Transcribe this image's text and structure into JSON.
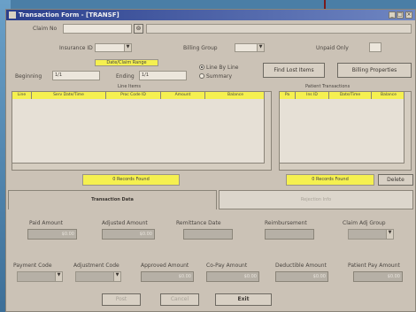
{
  "window": {
    "title": "Transaction Form - [TRANSF]"
  },
  "header": {
    "claim_no_label": "Claim No",
    "claim_no_value": "",
    "insurance_id_label": "Insurance ID",
    "billing_group_label": "Billing Group",
    "unpaid_only_label": "Unpaid Only",
    "date_range_label": "Date/Claim Range",
    "beginning_label": "Beginning",
    "beginning_value": "1/1",
    "ending_label": "Ending",
    "ending_value": "1/1",
    "radio_line_by_line": "Line By Line",
    "radio_summary": "Summary",
    "find_lost_items_label": "Find Lost Items",
    "billing_properties_label": "Billing Properties"
  },
  "left_grid": {
    "group_label": "Line Items",
    "columns": [
      "Line",
      "Serv Date/Time",
      "Proc Code ID",
      "Amount",
      "Balance"
    ],
    "count_label": "0 Records Found"
  },
  "right_grid": {
    "group_label": "Patient Transactions",
    "columns": [
      "Pa",
      "Ins ID",
      "Date/Time",
      "Balance"
    ],
    "count_label": "0 Records Found",
    "delete_label": "Delete"
  },
  "tabs": {
    "active": "Transaction Data",
    "inactive": "Rejection Info"
  },
  "amounts": {
    "row1": [
      {
        "label": "Paid Amount",
        "value": "$0.00"
      },
      {
        "label": "Adjusted Amount",
        "value": "$0.00"
      },
      {
        "label": "Remittance Date",
        "value": ""
      },
      {
        "label": "Reimbursement",
        "value": ""
      },
      {
        "label": "Claim Adj Group",
        "value": ""
      }
    ],
    "row2": [
      {
        "label": "Payment Code",
        "value": ""
      },
      {
        "label": "Adjustment Code",
        "value": ""
      },
      {
        "label": "Approved Amount",
        "value": "$0.00"
      },
      {
        "label": "Co-Pay Amount",
        "value": "$0.00"
      },
      {
        "label": "Deductible Amount",
        "value": "$0.00"
      },
      {
        "label": "Patient Pay Amount",
        "value": "$0.00"
      }
    ]
  },
  "footer": {
    "post_label": "Post",
    "cancel_label": "Cancel",
    "exit_label": "Exit"
  }
}
